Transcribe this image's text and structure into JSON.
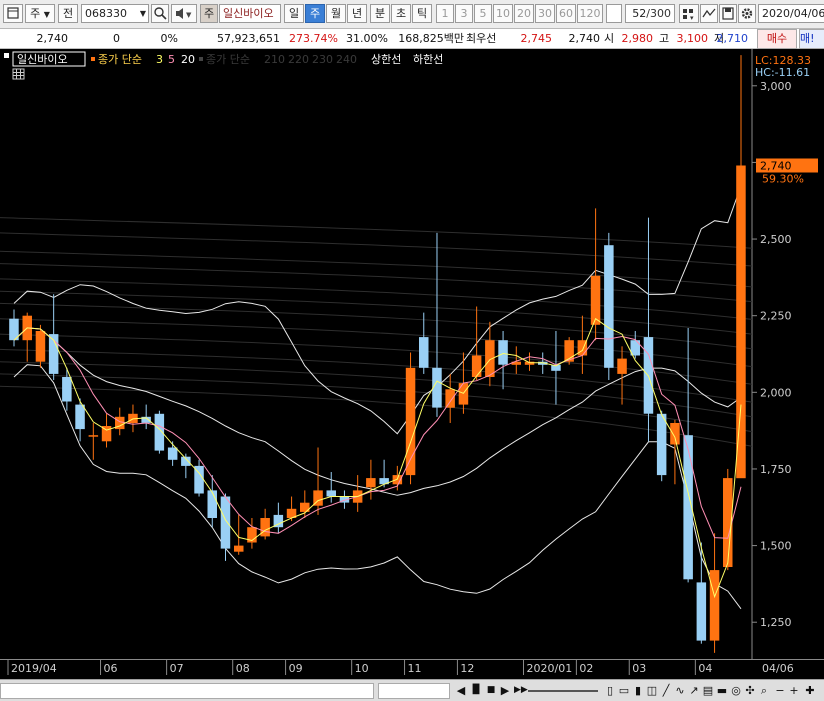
{
  "toolbar": {
    "type_label": "주",
    "market_label": "전",
    "code": "068330",
    "name_badge": "주",
    "name": "일신바이오",
    "periods": [
      "일",
      "주",
      "월",
      "년",
      "분",
      "초",
      "틱"
    ],
    "active_period_index": 1,
    "intervals": [
      "1",
      "3",
      "5",
      "10",
      "20",
      "30",
      "60",
      "120"
    ],
    "count": "52",
    "count_total": "/300",
    "date": "2020/04/06"
  },
  "quote": {
    "price": "2,740",
    "change": "0",
    "change_pct": "0%",
    "volume": "57,923,651",
    "volume_ratio": "273.74%",
    "turnover_ratio": "31.00%",
    "amount": "168,825백만",
    "best_label": "최우선",
    "best_ask": "2,745",
    "best_bid": "2,740",
    "open_label": "시",
    "open": "2,980",
    "high_label": "고",
    "high": "3,100",
    "low_label": "저",
    "low": "2,710",
    "buy_label": "매수",
    "sell_label": "매!"
  },
  "legend": {
    "name": "일신바이오",
    "ma_label": "종가 단순",
    "ma_periods": [
      "3",
      "5",
      "20"
    ],
    "ma_long_label": "종가 단순",
    "ma_long_periods": [
      "210",
      "220",
      "230",
      "240"
    ],
    "limit_label": "상한선",
    "limit_label2": "하한선"
  },
  "side_info": {
    "lc": "LC:128.33",
    "hc": "HC:-11.61",
    "price_tag": "2,740",
    "pct_tag": "59.30%"
  },
  "colors": {
    "up": "#ff7311",
    "down": "#9ad0f5",
    "ma3": "#ffff66",
    "ma5": "#ff8fb4",
    "band": "#e8e8e8"
  },
  "chart_data": {
    "type": "candlestick",
    "period": "weekly",
    "y_axis_ticks": [
      "3,000",
      "2,750",
      "2,500",
      "2,250",
      "2,000",
      "1,750",
      "1,500",
      "1,250"
    ],
    "y_ticks_values": [
      3000,
      2750,
      2500,
      2250,
      2000,
      1750,
      1500,
      1250
    ],
    "ylim": [
      1130,
      3120
    ],
    "x_axis_labels": [
      "2019/04",
      "06",
      "07",
      "08",
      "09",
      "10",
      "11",
      "12",
      "2020/01",
      "02",
      "03",
      "04",
      "04/06"
    ],
    "x_label_index": [
      0,
      7,
      12,
      17,
      21,
      26,
      30,
      34,
      39,
      43,
      47,
      52
    ],
    "candles": [
      {
        "o": 2240,
        "c": 2170,
        "h": 2270,
        "l": 2150
      },
      {
        "o": 2170,
        "c": 2250,
        "h": 2260,
        "l": 2100
      },
      {
        "o": 2100,
        "c": 2200,
        "h": 2220,
        "l": 2080
      },
      {
        "o": 2190,
        "c": 2060,
        "h": 2320,
        "l": 2040
      },
      {
        "o": 2050,
        "c": 1970,
        "h": 2080,
        "l": 1940
      },
      {
        "o": 1960,
        "c": 1880,
        "h": 1980,
        "l": 1840
      },
      {
        "o": 1860,
        "c": 1860,
        "h": 1900,
        "l": 1780
      },
      {
        "o": 1840,
        "c": 1890,
        "h": 1930,
        "l": 1820
      },
      {
        "o": 1880,
        "c": 1920,
        "h": 1950,
        "l": 1860
      },
      {
        "o": 1900,
        "c": 1930,
        "h": 1960,
        "l": 1870
      },
      {
        "o": 1920,
        "c": 1900,
        "h": 1960,
        "l": 1880
      },
      {
        "o": 1930,
        "c": 1810,
        "h": 1940,
        "l": 1800
      },
      {
        "o": 1820,
        "c": 1780,
        "h": 1840,
        "l": 1760
      },
      {
        "o": 1790,
        "c": 1760,
        "h": 1800,
        "l": 1720
      },
      {
        "o": 1760,
        "c": 1670,
        "h": 1780,
        "l": 1660
      },
      {
        "o": 1680,
        "c": 1590,
        "h": 1730,
        "l": 1560
      },
      {
        "o": 1660,
        "c": 1490,
        "h": 1670,
        "l": 1450
      },
      {
        "o": 1480,
        "c": 1500,
        "h": 1600,
        "l": 1470
      },
      {
        "o": 1510,
        "c": 1560,
        "h": 1590,
        "l": 1490
      },
      {
        "o": 1530,
        "c": 1590,
        "h": 1620,
        "l": 1520
      },
      {
        "o": 1600,
        "c": 1560,
        "h": 1640,
        "l": 1540
      },
      {
        "o": 1590,
        "c": 1620,
        "h": 1660,
        "l": 1580
      },
      {
        "o": 1610,
        "c": 1640,
        "h": 1680,
        "l": 1590
      },
      {
        "o": 1630,
        "c": 1680,
        "h": 1820,
        "l": 1600
      },
      {
        "o": 1680,
        "c": 1660,
        "h": 1740,
        "l": 1640
      },
      {
        "o": 1660,
        "c": 1640,
        "h": 1680,
        "l": 1620
      },
      {
        "o": 1640,
        "c": 1680,
        "h": 1730,
        "l": 1610
      },
      {
        "o": 1690,
        "c": 1720,
        "h": 1780,
        "l": 1650
      },
      {
        "o": 1720,
        "c": 1700,
        "h": 1780,
        "l": 1690
      },
      {
        "o": 1700,
        "c": 1730,
        "h": 1760,
        "l": 1680
      },
      {
        "o": 1730,
        "c": 2080,
        "h": 2130,
        "l": 1700
      },
      {
        "o": 2180,
        "c": 2080,
        "h": 2260,
        "l": 2060
      },
      {
        "o": 2080,
        "c": 1950,
        "h": 2520,
        "l": 1920
      },
      {
        "o": 1950,
        "c": 2010,
        "h": 2060,
        "l": 1900
      },
      {
        "o": 1960,
        "c": 2030,
        "h": 2130,
        "l": 1930
      },
      {
        "o": 2050,
        "c": 2120,
        "h": 2280,
        "l": 2040
      },
      {
        "o": 2050,
        "c": 2170,
        "h": 2230,
        "l": 2020
      },
      {
        "o": 2170,
        "c": 2090,
        "h": 2200,
        "l": 2010
      },
      {
        "o": 2090,
        "c": 2100,
        "h": 2150,
        "l": 2060
      },
      {
        "o": 2090,
        "c": 2100,
        "h": 2130,
        "l": 2070
      },
      {
        "o": 2100,
        "c": 2090,
        "h": 2130,
        "l": 2060
      },
      {
        "o": 2090,
        "c": 2070,
        "h": 2200,
        "l": 1960
      },
      {
        "o": 2100,
        "c": 2170,
        "h": 2180,
        "l": 2090
      },
      {
        "o": 2120,
        "c": 2170,
        "h": 2250,
        "l": 2060
      },
      {
        "o": 2220,
        "c": 2380,
        "h": 2600,
        "l": 2170
      },
      {
        "o": 2480,
        "c": 2080,
        "h": 2520,
        "l": 2040
      },
      {
        "o": 2060,
        "c": 2110,
        "h": 2150,
        "l": 1960
      },
      {
        "o": 2170,
        "c": 2120,
        "h": 2200,
        "l": 2110
      },
      {
        "o": 2180,
        "c": 1930,
        "h": 2570,
        "l": 1840
      },
      {
        "o": 1930,
        "c": 1730,
        "h": 1940,
        "l": 1710
      },
      {
        "o": 1830,
        "c": 1900,
        "h": 1910,
        "l": 1700
      },
      {
        "o": 1860,
        "c": 1390,
        "h": 2210,
        "l": 1380
      },
      {
        "o": 1380,
        "c": 1190,
        "h": 1510,
        "l": 1180
      },
      {
        "o": 1190,
        "c": 1420,
        "h": 1540,
        "l": 1150
      },
      {
        "o": 1430,
        "c": 1720,
        "h": 1750,
        "l": 1420
      },
      {
        "o": 1720,
        "c": 2740,
        "h": 3100,
        "l": 1730
      }
    ]
  }
}
